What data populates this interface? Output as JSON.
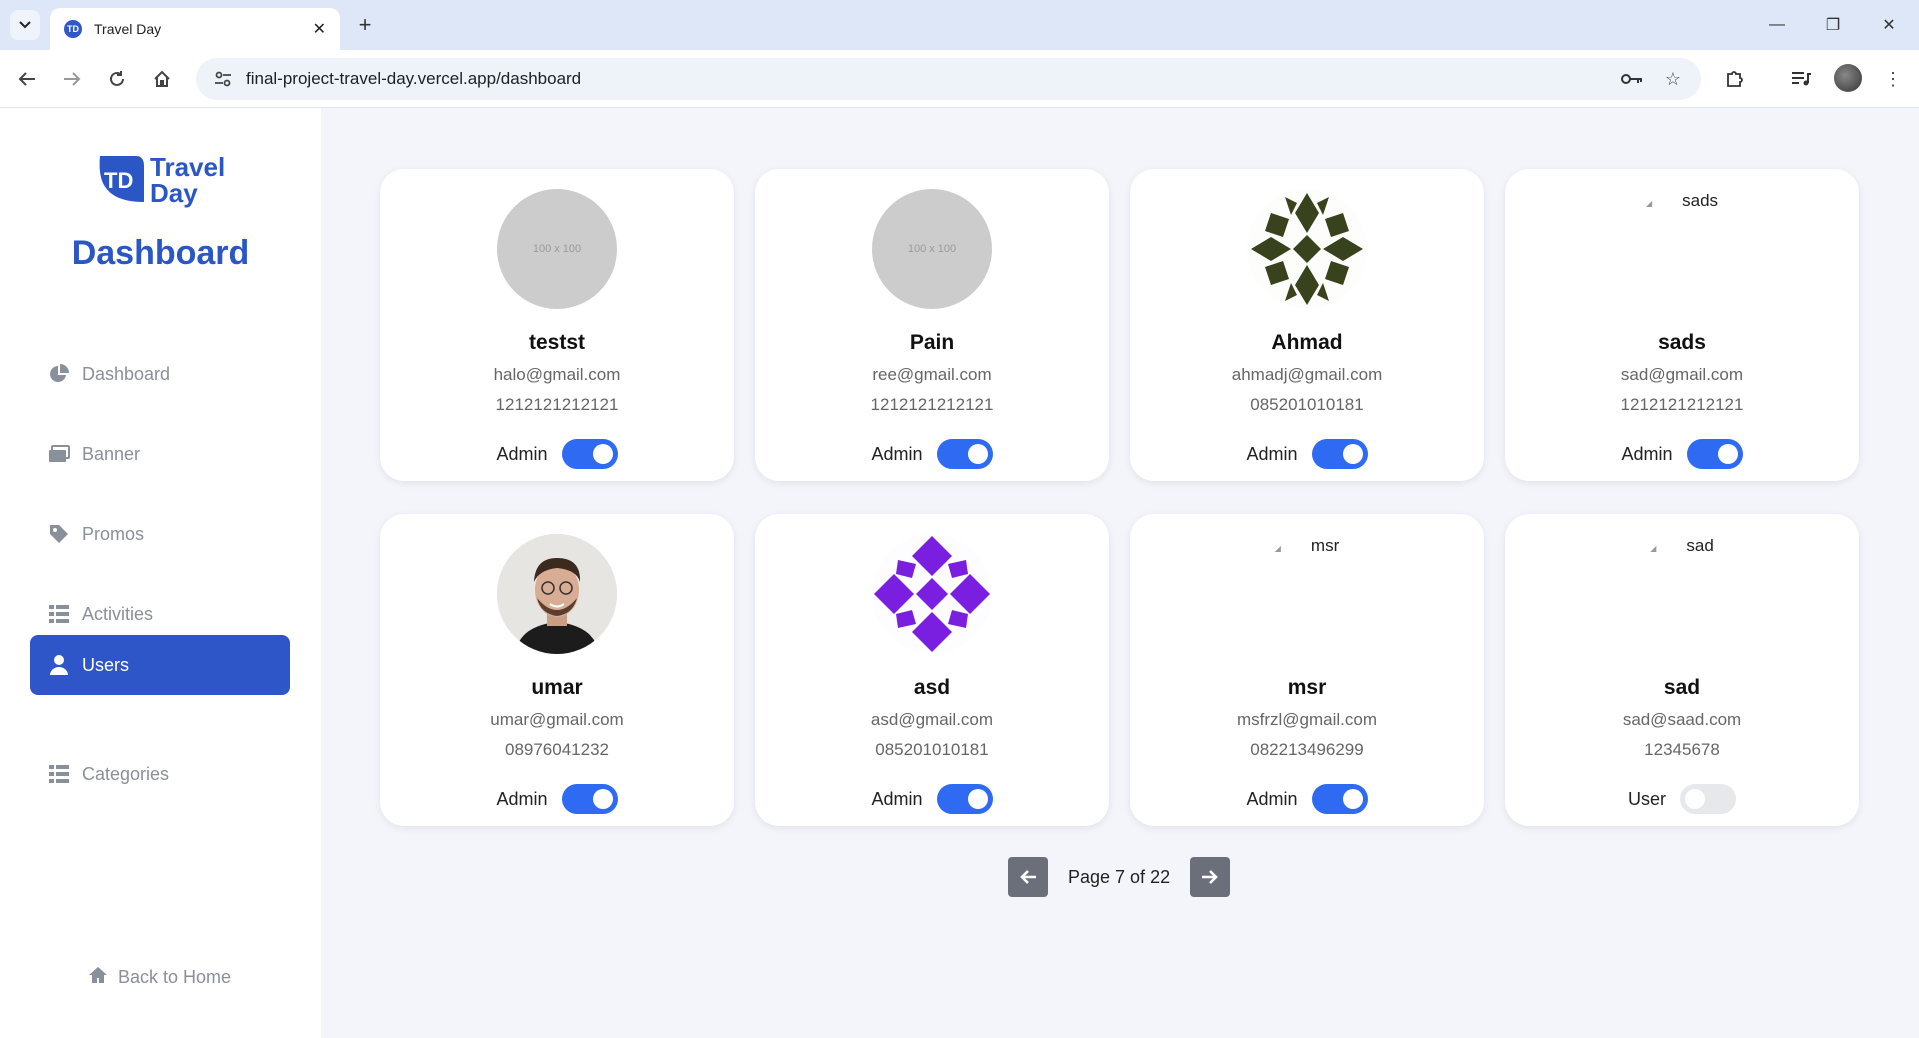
{
  "browser": {
    "tab_title": "Travel Day",
    "url": "final-project-travel-day.vercel.app/dashboard"
  },
  "sidebar": {
    "logo_line1": "Travel",
    "logo_line2": "Day",
    "logo_mark": "TD",
    "title": "Dashboard",
    "items": [
      {
        "label": "Dashboard",
        "icon": "pie-chart-icon"
      },
      {
        "label": "Banner",
        "icon": "images-icon"
      },
      {
        "label": "Promos",
        "icon": "tag-icon"
      },
      {
        "label": "Activities",
        "icon": "list-icon"
      },
      {
        "label": "Users",
        "icon": "user-icon",
        "active": true
      },
      {
        "label": "Categories",
        "icon": "list-icon"
      }
    ],
    "back_home": "Back to Home"
  },
  "users": [
    {
      "name": "testst",
      "email": "halo@gmail.com",
      "phone": "1212121212121",
      "role": "Admin",
      "avatar": "placeholder",
      "avatar_text": "100 x 100",
      "admin": true
    },
    {
      "name": "Pain",
      "email": "ree@gmail.com",
      "phone": "1212121212121",
      "role": "Admin",
      "avatar": "placeholder",
      "avatar_text": "100 x 100",
      "admin": true
    },
    {
      "name": "Ahmad",
      "email": "ahmadj@gmail.com",
      "phone": "085201010181",
      "role": "Admin",
      "avatar": "pattern-green",
      "admin": true
    },
    {
      "name": "sads",
      "email": "sad@gmail.com",
      "phone": "1212121212121",
      "role": "Admin",
      "avatar": "broken",
      "avatar_text": "sads",
      "admin": true
    },
    {
      "name": "umar",
      "email": "umar@gmail.com",
      "phone": "08976041232",
      "role": "Admin",
      "avatar": "photo",
      "admin": true
    },
    {
      "name": "asd",
      "email": "asd@gmail.com",
      "phone": "085201010181",
      "role": "Admin",
      "avatar": "pattern-purple",
      "admin": true
    },
    {
      "name": "msr",
      "email": "msfrzl@gmail.com",
      "phone": "082213496299",
      "role": "Admin",
      "avatar": "broken",
      "avatar_text": "msr",
      "admin": true
    },
    {
      "name": "sad",
      "email": "sad@saad.com",
      "phone": "12345678",
      "role": "User",
      "avatar": "broken",
      "avatar_text": "sad",
      "admin": false
    }
  ],
  "pagination": {
    "text": "Page 7 of 22"
  },
  "colors": {
    "accent": "#2e56c8",
    "toggle_on": "#2e6bf2",
    "background": "#f3f5fb"
  }
}
